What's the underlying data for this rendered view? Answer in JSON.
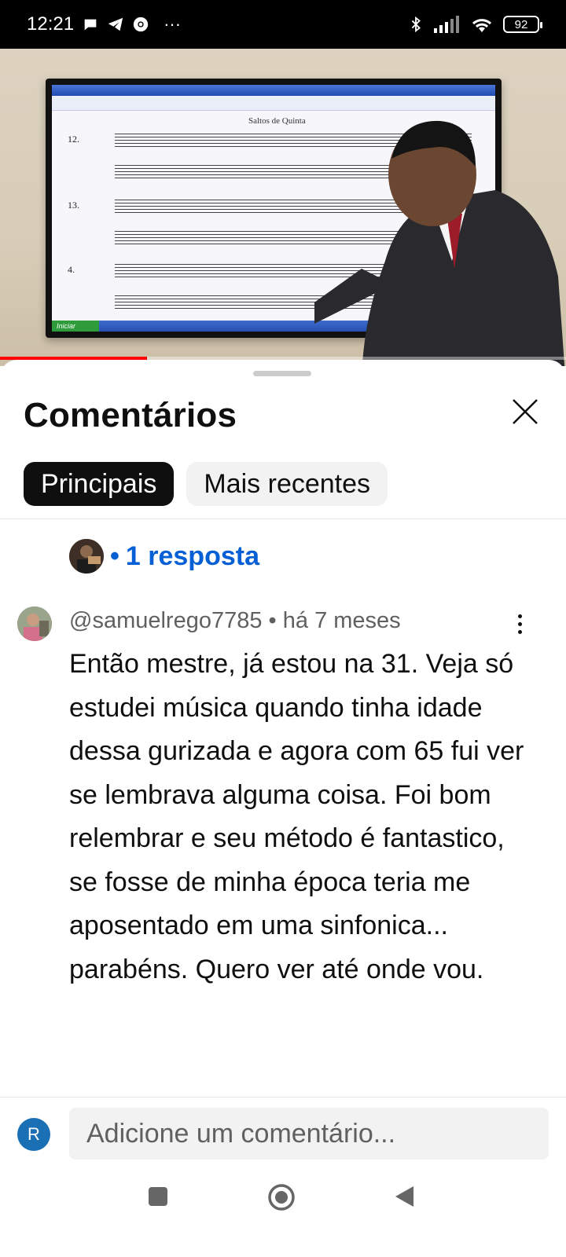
{
  "status_bar": {
    "time": "12:21",
    "more": "···",
    "battery": "92",
    "icons": [
      "chat-bubble-icon",
      "telegram-icon",
      "chrome-icon",
      "bluetooth-icon",
      "signal-icon",
      "wifi-icon",
      "battery-icon"
    ]
  },
  "video": {
    "sheet_title": "Saltos de Quinta",
    "staff_numbers": [
      "12.",
      "13.",
      "4."
    ],
    "taskbar_start": "Iniciar",
    "progress": 0.26,
    "progress_color": "#ff0000"
  },
  "comments_panel": {
    "title": "Comentários",
    "tabs": [
      {
        "label": "Principais",
        "active": true
      },
      {
        "label": "Mais recentes",
        "active": false
      }
    ],
    "reply_link": "1 resposta",
    "reply_bullet": "•",
    "comment": {
      "author": "@samuelrego7785",
      "separator": "•",
      "time": "há 7 meses",
      "text": "Então mestre, já estou na 31. Veja só estudei música quando tinha idade dessa gurizada e agora com 65 fui ver se lembrava alguma coisa. Foi bom relembrar e seu método é fantastico, se fosse de minha época teria me aposentado em uma sinfonica... parabéns. Quero ver até onde vou."
    },
    "compose": {
      "avatar_letter": "R",
      "placeholder": "Adicione um comentário..."
    }
  },
  "colors": {
    "accent_link": "#065fd4",
    "chip_active_bg": "#0f0f0f",
    "chip_bg": "#f2f2f2"
  }
}
